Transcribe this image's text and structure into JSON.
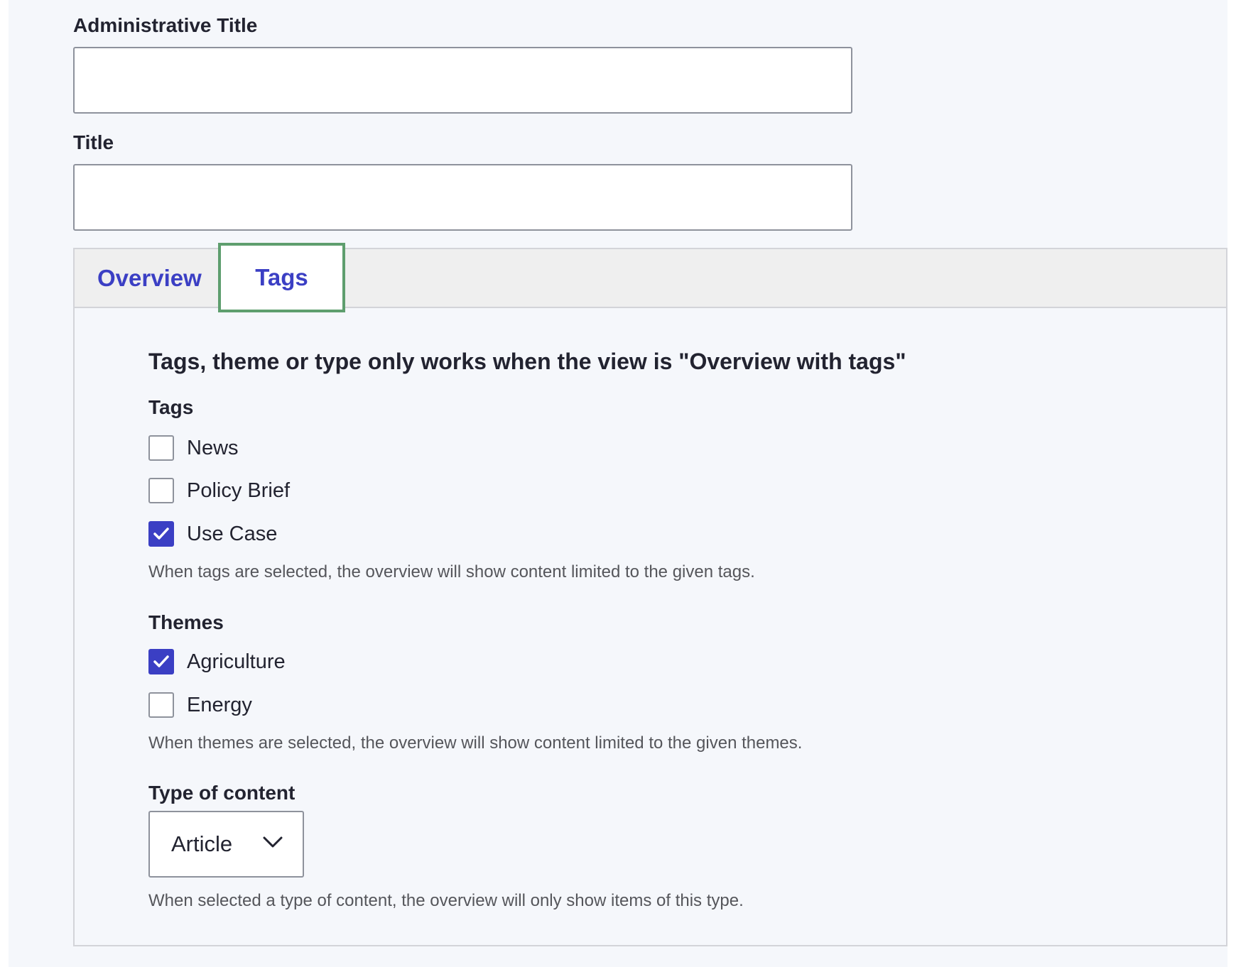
{
  "fields": {
    "admin_title": {
      "label": "Administrative Title",
      "value": ""
    },
    "title": {
      "label": "Title",
      "value": ""
    }
  },
  "tabs": [
    {
      "label": "Overview",
      "active": false
    },
    {
      "label": "Tags",
      "active": true
    }
  ],
  "panel": {
    "heading": "Tags, theme or type only works when the view is \"Overview with tags\"",
    "tags": {
      "label": "Tags",
      "options": [
        {
          "label": "News",
          "checked": false
        },
        {
          "label": "Policy Brief",
          "checked": false
        },
        {
          "label": "Use Case",
          "checked": true
        }
      ],
      "description": "When tags are selected, the overview will show content limited to the given tags."
    },
    "themes": {
      "label": "Themes",
      "options": [
        {
          "label": "Agriculture",
          "checked": true
        },
        {
          "label": "Energy",
          "checked": false
        }
      ],
      "description": "When themes are selected, the overview will show content limited to the given themes."
    },
    "content_type": {
      "label": "Type of content",
      "selected": "Article",
      "description": "When selected a type of content, the overview will only show items of this type."
    }
  },
  "colors": {
    "accent": "#3b3fc4",
    "focus_outline": "#5e9e6e",
    "text": "#222330",
    "muted_text": "#55565b",
    "border": "#8e929c"
  },
  "icons": {
    "checkmark": "checkmark-icon",
    "dropdown": "chevron-down-icon"
  }
}
